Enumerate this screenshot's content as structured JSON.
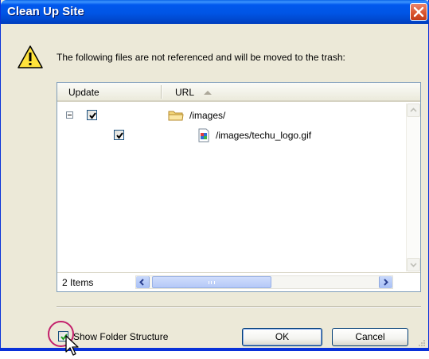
{
  "window": {
    "title": "Clean Up Site"
  },
  "message": "The following files are not referenced and will be moved to the trash:",
  "list": {
    "columns": [
      {
        "label": "Update"
      },
      {
        "label": "URL"
      }
    ],
    "rows": [
      {
        "type": "folder",
        "url": "/images/",
        "checked": true
      },
      {
        "type": "file",
        "url": "/images/techu_logo.gif",
        "checked": true
      }
    ],
    "status": "2 Items"
  },
  "options": {
    "show_folder_structure_label": "Show Folder Structure",
    "show_folder_structure_checked": true
  },
  "buttons": {
    "ok_label": "OK",
    "cancel_label": "Cancel"
  },
  "colors": {
    "titlebar": "#0058ee",
    "close_button": "#d9532c",
    "dialog_bg": "#ece9d8",
    "highlight_circle": "#c3206b"
  },
  "icons": [
    "close-icon",
    "warning-icon",
    "minus-expander-icon",
    "folder-icon",
    "image-file-icon",
    "sort-ascending-icon",
    "mouse-cursor-icon"
  ]
}
